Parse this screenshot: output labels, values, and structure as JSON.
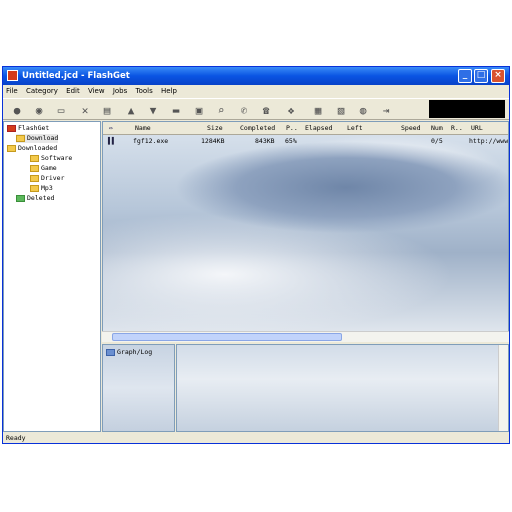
{
  "window": {
    "title": "Untitled.jcd - FlashGet"
  },
  "menu": [
    "File",
    "Category",
    "Edit",
    "View",
    "Jobs",
    "Tools",
    "Help"
  ],
  "toolbar_icons": [
    "start-icon",
    "pause-icon",
    "new-icon",
    "delete-icon",
    "properties-icon",
    "up-icon",
    "down-icon",
    "folder-icon",
    "open-folder-icon",
    "find-icon",
    "dial-icon",
    "phone-icon",
    "theme-icon",
    "site-explorer-icon",
    "options-icon",
    "monitor-icon",
    "exit-icon"
  ],
  "tree": {
    "root": "FlashGet",
    "items": [
      "Download",
      "Downloaded",
      "Software",
      "Game",
      "Driver",
      "Mp3",
      "Deleted"
    ]
  },
  "list": {
    "headers": [
      "Name",
      "Size",
      "Completed",
      "P..",
      "Elapsed",
      "Left",
      "Speed",
      "Num",
      "R..",
      "URL"
    ],
    "rows": [
      {
        "name": "fgf12.exe",
        "size": "1284KB",
        "completed": "843KB",
        "percent": "65%",
        "elapsed": "",
        "left": "",
        "speed": "",
        "num": "0/5",
        "r": "",
        "url": "http://www."
      }
    ]
  },
  "bottom": {
    "graph_label": "Graph/Log"
  },
  "status": {
    "text": "Ready"
  }
}
